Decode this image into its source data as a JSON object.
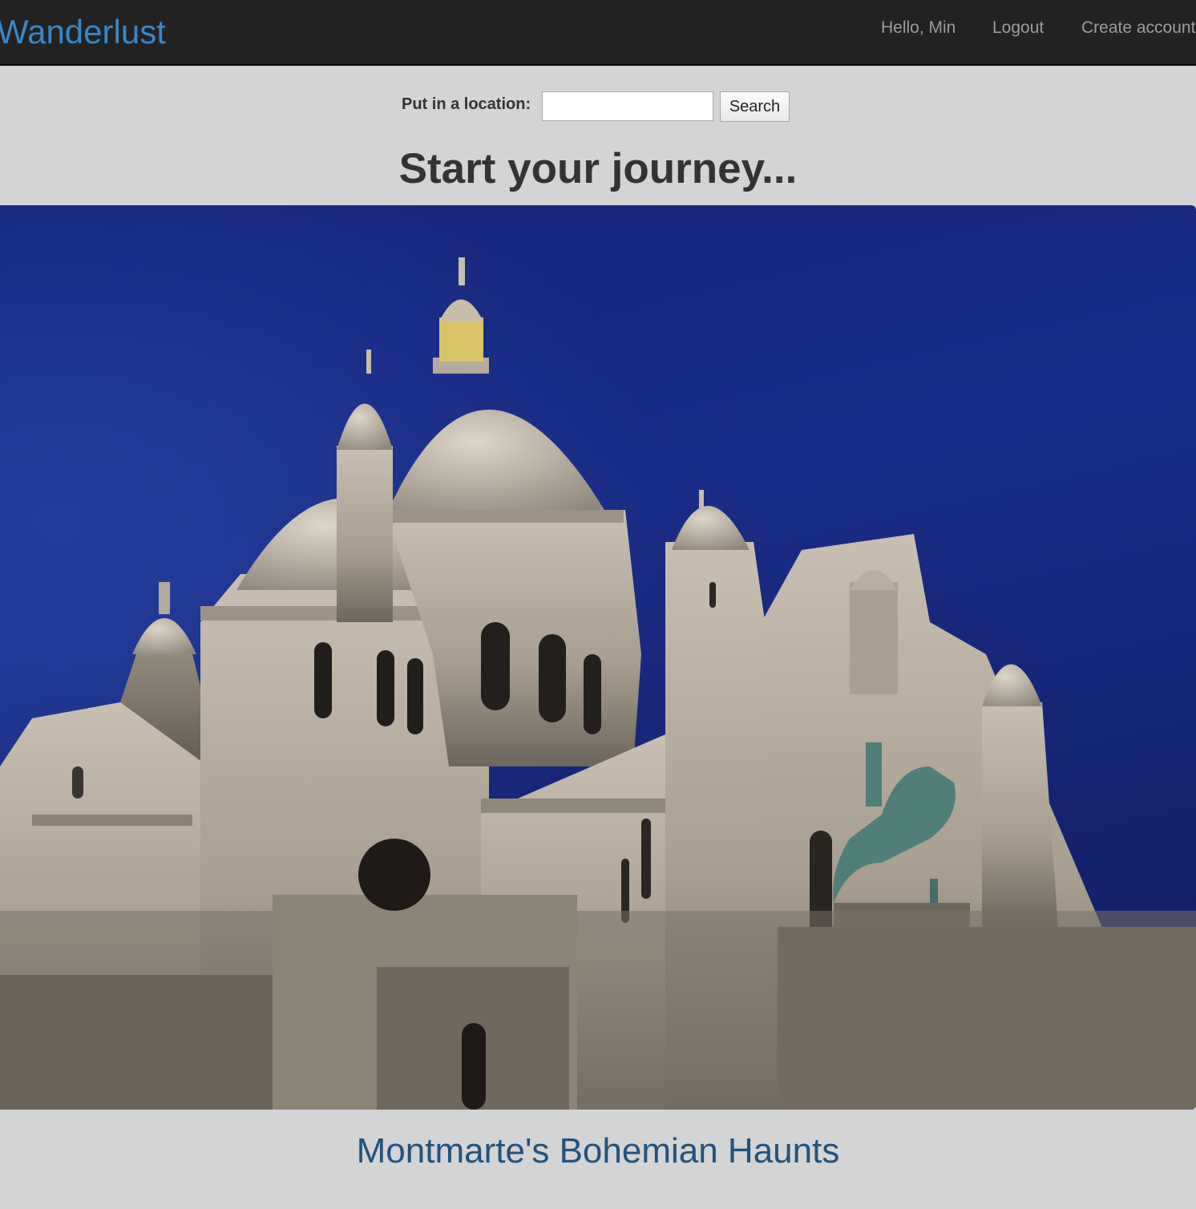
{
  "navbar": {
    "brand": "Wanderlust",
    "greeting": "Hello, Min",
    "logout": "Logout",
    "create_account": "Create account"
  },
  "search": {
    "label": "Put in a location:",
    "value": "",
    "button": "Search"
  },
  "main": {
    "heading": "Start your journey...",
    "caption": "Montmarte's Bohemian Haunts"
  },
  "colors": {
    "navbar_bg": "#222222",
    "brand": "#3a86c8",
    "nav_link": "#9d9d9d",
    "page_bg": "#d3d4d6",
    "caption_link": "#23527c",
    "sky": "#16267a"
  },
  "icons": {
    "hero_image": "basilica-night-photo"
  }
}
